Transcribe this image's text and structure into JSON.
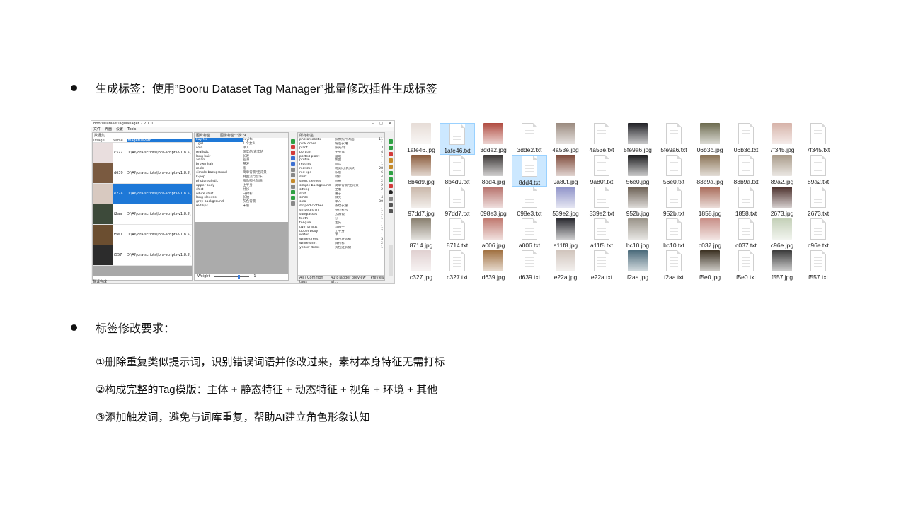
{
  "bullets": {
    "b1": "生成标签：使用”Booru Dataset Tag Manager”批量修改插件生成标签",
    "b2": "标签修改要求："
  },
  "requirements": [
    "①删除重复类似提示词，识别错误词语并修改过来，素材本身特征无需打标",
    "②构成完整的Tag模版：主体 + 静态特征 + 动态特征 + 视角 + 环境 + 其他",
    "③添加触发词，避免与词库重复，帮助AI建立角色形象认知"
  ],
  "app": {
    "title": "BooruDatasetTagManager 2.2.1.0",
    "menu": [
      "文件",
      "界面",
      "设置",
      "Tools"
    ],
    "dataset_label": "数据集",
    "image_cols": [
      "Image",
      "Name",
      "ImageFilePath"
    ],
    "images": [
      {
        "name": "c327",
        "path": "D:\\AI\\lora-scripts\\lora-scripts-v1.8.5\\",
        "color": "#e9dede",
        "selected": false
      },
      {
        "name": "d639",
        "path": "D:\\AI\\lora-scripts\\lora-scripts-v1.8.5\\",
        "color": "#7a5a40",
        "selected": false
      },
      {
        "name": "e22a",
        "path": "D:\\AI\\lora-scripts\\lora-scripts-v1.8.5\\",
        "color": "#d8c9c0",
        "selected": true
      },
      {
        "name": "f2aa",
        "path": "D:\\AI\\lora-scripts\\lora-scripts-v1.8.5\\",
        "color": "#3d4a3a",
        "selected": false
      },
      {
        "name": "f5e0",
        "path": "D:\\AI\\lora-scripts\\lora-scripts-v1.8.5\\",
        "color": "#6b4e30",
        "selected": false
      },
      {
        "name": "f557",
        "path": "D:\\AI\\lora-scripts\\lora-scripts-v1.8.5\\",
        "color": "#2c2c2c",
        "selected": false
      }
    ],
    "image_tags_header": [
      "图片标签",
      "图像标签个数: 9"
    ],
    "image_tags": [
      {
        "en": "liuyifei",
        "zh": "liuyifei",
        "sel": true
      },
      {
        "en": "1girl",
        "zh": "1 个女人"
      },
      {
        "en": "solo",
        "zh": "单人"
      },
      {
        "en": "realistic",
        "zh": "现实的/真实的"
      },
      {
        "en": "long hair",
        "zh": "长发"
      },
      {
        "en": "asian",
        "zh": "亚洲"
      },
      {
        "en": "brown hair",
        "zh": "茶发"
      },
      {
        "en": "mole",
        "zh": "痣"
      },
      {
        "en": "simple background",
        "zh": "简单背景/无背景"
      },
      {
        "en": "k-pop",
        "zh": "韩国流行音乐"
      },
      {
        "en": "photorealistic",
        "zh": "照像照片的画"
      },
      {
        "en": "upper body",
        "zh": "上半身"
      },
      {
        "en": "shirt",
        "zh": "衬衫"
      },
      {
        "en": "white shirt",
        "zh": "白衬衫"
      },
      {
        "en": "long sleeves",
        "zh": "长袖"
      },
      {
        "en": "grey background",
        "zh": "灰色背景"
      },
      {
        "en": "red lips",
        "zh": "朱唇"
      }
    ],
    "weights_label": "Weight",
    "weights_value": "1",
    "all_tags_header": "所有标签",
    "all_tags": [
      {
        "en": "photorealistic",
        "zh": "照像照片的画",
        "n": "11"
      },
      {
        "en": "pink dress",
        "zh": "粉连衣裙",
        "n": "1"
      },
      {
        "en": "plant",
        "zh": "阳光/绿",
        "n": "3"
      },
      {
        "en": "portrait",
        "zh": "半身像",
        "n": "4"
      },
      {
        "en": "potted plant",
        "zh": "盆栽",
        "n": "1"
      },
      {
        "en": "profile",
        "zh": "侧面",
        "n": "1"
      },
      {
        "en": "reading",
        "zh": "阅读",
        "n": "1"
      },
      {
        "en": "realistic",
        "zh": "现实的/真实的",
        "n": "28"
      },
      {
        "en": "red lips",
        "zh": "朱唇",
        "n": "6"
      },
      {
        "en": "shirt",
        "zh": "衬衫",
        "n": "4"
      },
      {
        "en": "short sleeves",
        "zh": "短袖",
        "n": "2"
      },
      {
        "en": "simple background",
        "zh": "简单背景/无背景",
        "n": "2"
      },
      {
        "en": "sitting",
        "zh": "坐着",
        "n": "2"
      },
      {
        "en": "skirt",
        "zh": "裙子",
        "n": "1"
      },
      {
        "en": "smile",
        "zh": "微笑",
        "n": "4"
      },
      {
        "en": "solo",
        "zh": "单人",
        "n": "30"
      },
      {
        "en": "striped clothes",
        "zh": "条纹衣服",
        "n": "1"
      },
      {
        "en": "striped shirt",
        "zh": "条纹衬衫",
        "n": "1"
      },
      {
        "en": "sunglasses",
        "zh": "太阳镜",
        "n": "1"
      },
      {
        "en": "teeth",
        "zh": "牙",
        "n": "1"
      },
      {
        "en": "tongue",
        "zh": "舌头",
        "n": "1"
      },
      {
        "en": "twin braids",
        "zh": "双辫子",
        "n": "1"
      },
      {
        "en": "upper body",
        "zh": "上半身",
        "n": "7"
      },
      {
        "en": "water",
        "zh": "水",
        "n": "1"
      },
      {
        "en": "white dress",
        "zh": "白色连衣裙",
        "n": "3"
      },
      {
        "en": "white shirt",
        "zh": "白衬衫",
        "n": "2"
      },
      {
        "en": "yellow dress",
        "zh": "黄色连衣裙",
        "n": "1"
      }
    ],
    "right_tabs": [
      "All / Common tags",
      "AutoTagger preview wi...",
      "Preview"
    ],
    "status": "翻译完成"
  },
  "files": [
    {
      "name": "1afe46.jpg",
      "kind": "img",
      "color": "#e6dcd6"
    },
    {
      "name": "1afe46.txt",
      "kind": "txt",
      "sel": true
    },
    {
      "name": "3dde2.jpg",
      "kind": "img",
      "color": "#b04a3f"
    },
    {
      "name": "3dde2.txt",
      "kind": "txt"
    },
    {
      "name": "4a53e.jpg",
      "kind": "img",
      "color": "#9a8a7e"
    },
    {
      "name": "4a53e.txt",
      "kind": "txt"
    },
    {
      "name": "5fe9a6.jpg",
      "kind": "img",
      "color": "#1f1f24"
    },
    {
      "name": "5fe9a6.txt",
      "kind": "txt"
    },
    {
      "name": "06b3c.jpg",
      "kind": "img",
      "color": "#6c6a4e"
    },
    {
      "name": "06b3c.txt",
      "kind": "txt"
    },
    {
      "name": "7f345.jpg",
      "kind": "img",
      "color": "#d6b2a8"
    },
    {
      "name": "7f345.txt",
      "kind": "txt"
    },
    {
      "name": "8b4d9.jpg",
      "kind": "img",
      "color": "#8a5a3a"
    },
    {
      "name": "8b4d9.txt",
      "kind": "txt"
    },
    {
      "name": "8dd4.jpg",
      "kind": "img",
      "color": "#3a3534"
    },
    {
      "name": "8dd4.txt",
      "kind": "txt",
      "sel": true
    },
    {
      "name": "9a80f.jpg",
      "kind": "img",
      "color": "#7f4a3a"
    },
    {
      "name": "9a80f.txt",
      "kind": "txt"
    },
    {
      "name": "56e0.jpg",
      "kind": "img",
      "color": "#1c1c1e"
    },
    {
      "name": "56e0.txt",
      "kind": "txt"
    },
    {
      "name": "83b9a.jpg",
      "kind": "img",
      "color": "#8a7254"
    },
    {
      "name": "83b9a.txt",
      "kind": "txt"
    },
    {
      "name": "89a2.jpg",
      "kind": "img",
      "color": "#a89a88"
    },
    {
      "name": "89a2.txt",
      "kind": "txt"
    },
    {
      "name": "97dd7.jpg",
      "kind": "img",
      "color": "#c8b6a8"
    },
    {
      "name": "97dd7.txt",
      "kind": "txt"
    },
    {
      "name": "098e3.jpg",
      "kind": "img",
      "color": "#b6706a"
    },
    {
      "name": "098e3.txt",
      "kind": "txt"
    },
    {
      "name": "539e2.jpg",
      "kind": "img",
      "color": "#8e92c8"
    },
    {
      "name": "539e2.txt",
      "kind": "txt"
    },
    {
      "name": "952b.jpg",
      "kind": "img",
      "color": "#6a5e52"
    },
    {
      "name": "952b.txt",
      "kind": "txt"
    },
    {
      "name": "1858.jpg",
      "kind": "img",
      "color": "#a86a58"
    },
    {
      "name": "1858.txt",
      "kind": "txt"
    },
    {
      "name": "2673.jpg",
      "kind": "img",
      "color": "#4a2e2a"
    },
    {
      "name": "2673.txt",
      "kind": "txt"
    },
    {
      "name": "8714.jpg",
      "kind": "img",
      "color": "#8a8070"
    },
    {
      "name": "8714.txt",
      "kind": "txt"
    },
    {
      "name": "a006.jpg",
      "kind": "img",
      "color": "#c07a70"
    },
    {
      "name": "a006.txt",
      "kind": "txt"
    },
    {
      "name": "a11f8.jpg",
      "kind": "img",
      "color": "#2a2a30"
    },
    {
      "name": "a11f8.txt",
      "kind": "txt"
    },
    {
      "name": "bc10.jpg",
      "kind": "img",
      "color": "#9a948a"
    },
    {
      "name": "bc10.txt",
      "kind": "txt"
    },
    {
      "name": "c037.jpg",
      "kind": "img",
      "color": "#c89088"
    },
    {
      "name": "c037.txt",
      "kind": "txt"
    },
    {
      "name": "c96e.jpg",
      "kind": "img",
      "color": "#c4d0b8"
    },
    {
      "name": "c96e.txt",
      "kind": "txt"
    },
    {
      "name": "c327.jpg",
      "kind": "img",
      "color": "#e0d0d0"
    },
    {
      "name": "c327.txt",
      "kind": "txt"
    },
    {
      "name": "d639.jpg",
      "kind": "img",
      "color": "#a07040"
    },
    {
      "name": "d639.txt",
      "kind": "txt"
    },
    {
      "name": "e22a.jpg",
      "kind": "img",
      "color": "#d0c4bc"
    },
    {
      "name": "e22a.txt",
      "kind": "txt"
    },
    {
      "name": "f2aa.jpg",
      "kind": "img",
      "color": "#4a6a7a"
    },
    {
      "name": "f2aa.txt",
      "kind": "txt"
    },
    {
      "name": "f5e0.jpg",
      "kind": "img",
      "color": "#3a3020"
    },
    {
      "name": "f5e0.txt",
      "kind": "txt"
    },
    {
      "name": "f557.jpg",
      "kind": "img",
      "color": "#3a3a3a"
    },
    {
      "name": "f557.txt",
      "kind": "txt"
    }
  ]
}
